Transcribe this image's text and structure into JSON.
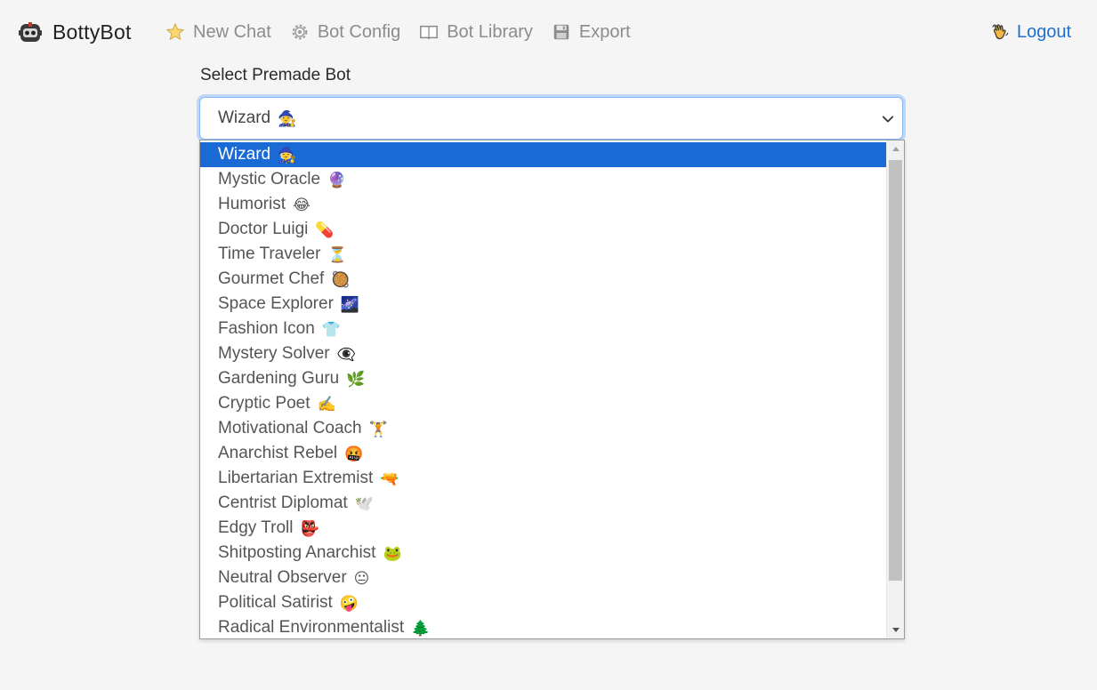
{
  "nav": {
    "brand": "BottyBot",
    "links": [
      {
        "label": "New Chat",
        "icon": "star-icon"
      },
      {
        "label": "Bot Config",
        "icon": "gear-icon"
      },
      {
        "label": "Bot Library",
        "icon": "book-icon"
      },
      {
        "label": "Export",
        "icon": "floppy-disk-icon"
      }
    ],
    "logout": "Logout"
  },
  "form": {
    "label": "Select Premade Bot",
    "selected": "Wizard",
    "selected_emoji": "🧙"
  },
  "options": [
    {
      "label": "Wizard",
      "emoji": "🧙"
    },
    {
      "label": "Mystic Oracle",
      "emoji": "🔮"
    },
    {
      "label": "Humorist",
      "emoji": "😂"
    },
    {
      "label": "Doctor Luigi",
      "emoji": "💊"
    },
    {
      "label": "Time Traveler",
      "emoji": "⏳"
    },
    {
      "label": "Gourmet Chef",
      "emoji": "🥘"
    },
    {
      "label": "Space Explorer",
      "emoji": "🌌"
    },
    {
      "label": "Fashion Icon",
      "emoji": "👕"
    },
    {
      "label": "Mystery Solver",
      "emoji": "👁️‍🗨️"
    },
    {
      "label": "Gardening Guru",
      "emoji": "🌿"
    },
    {
      "label": "Cryptic Poet",
      "emoji": "✍️"
    },
    {
      "label": "Motivational Coach",
      "emoji": "🏋️"
    },
    {
      "label": "Anarchist Rebel",
      "emoji": "🤬"
    },
    {
      "label": "Libertarian Extremist",
      "emoji": "🔫"
    },
    {
      "label": "Centrist Diplomat",
      "emoji": "🕊️"
    },
    {
      "label": "Edgy Troll",
      "emoji": "👺"
    },
    {
      "label": "Shitposting Anarchist",
      "emoji": "🐸"
    },
    {
      "label": "Neutral Observer",
      "emoji": "😐"
    },
    {
      "label": "Political Satirist",
      "emoji": "🤪"
    },
    {
      "label": "Radical Environmentalist",
      "emoji": "🌲"
    }
  ],
  "colors": {
    "accent": "#1a6ad6",
    "link": "#1e6fd0",
    "muted": "#8c8c8c"
  }
}
